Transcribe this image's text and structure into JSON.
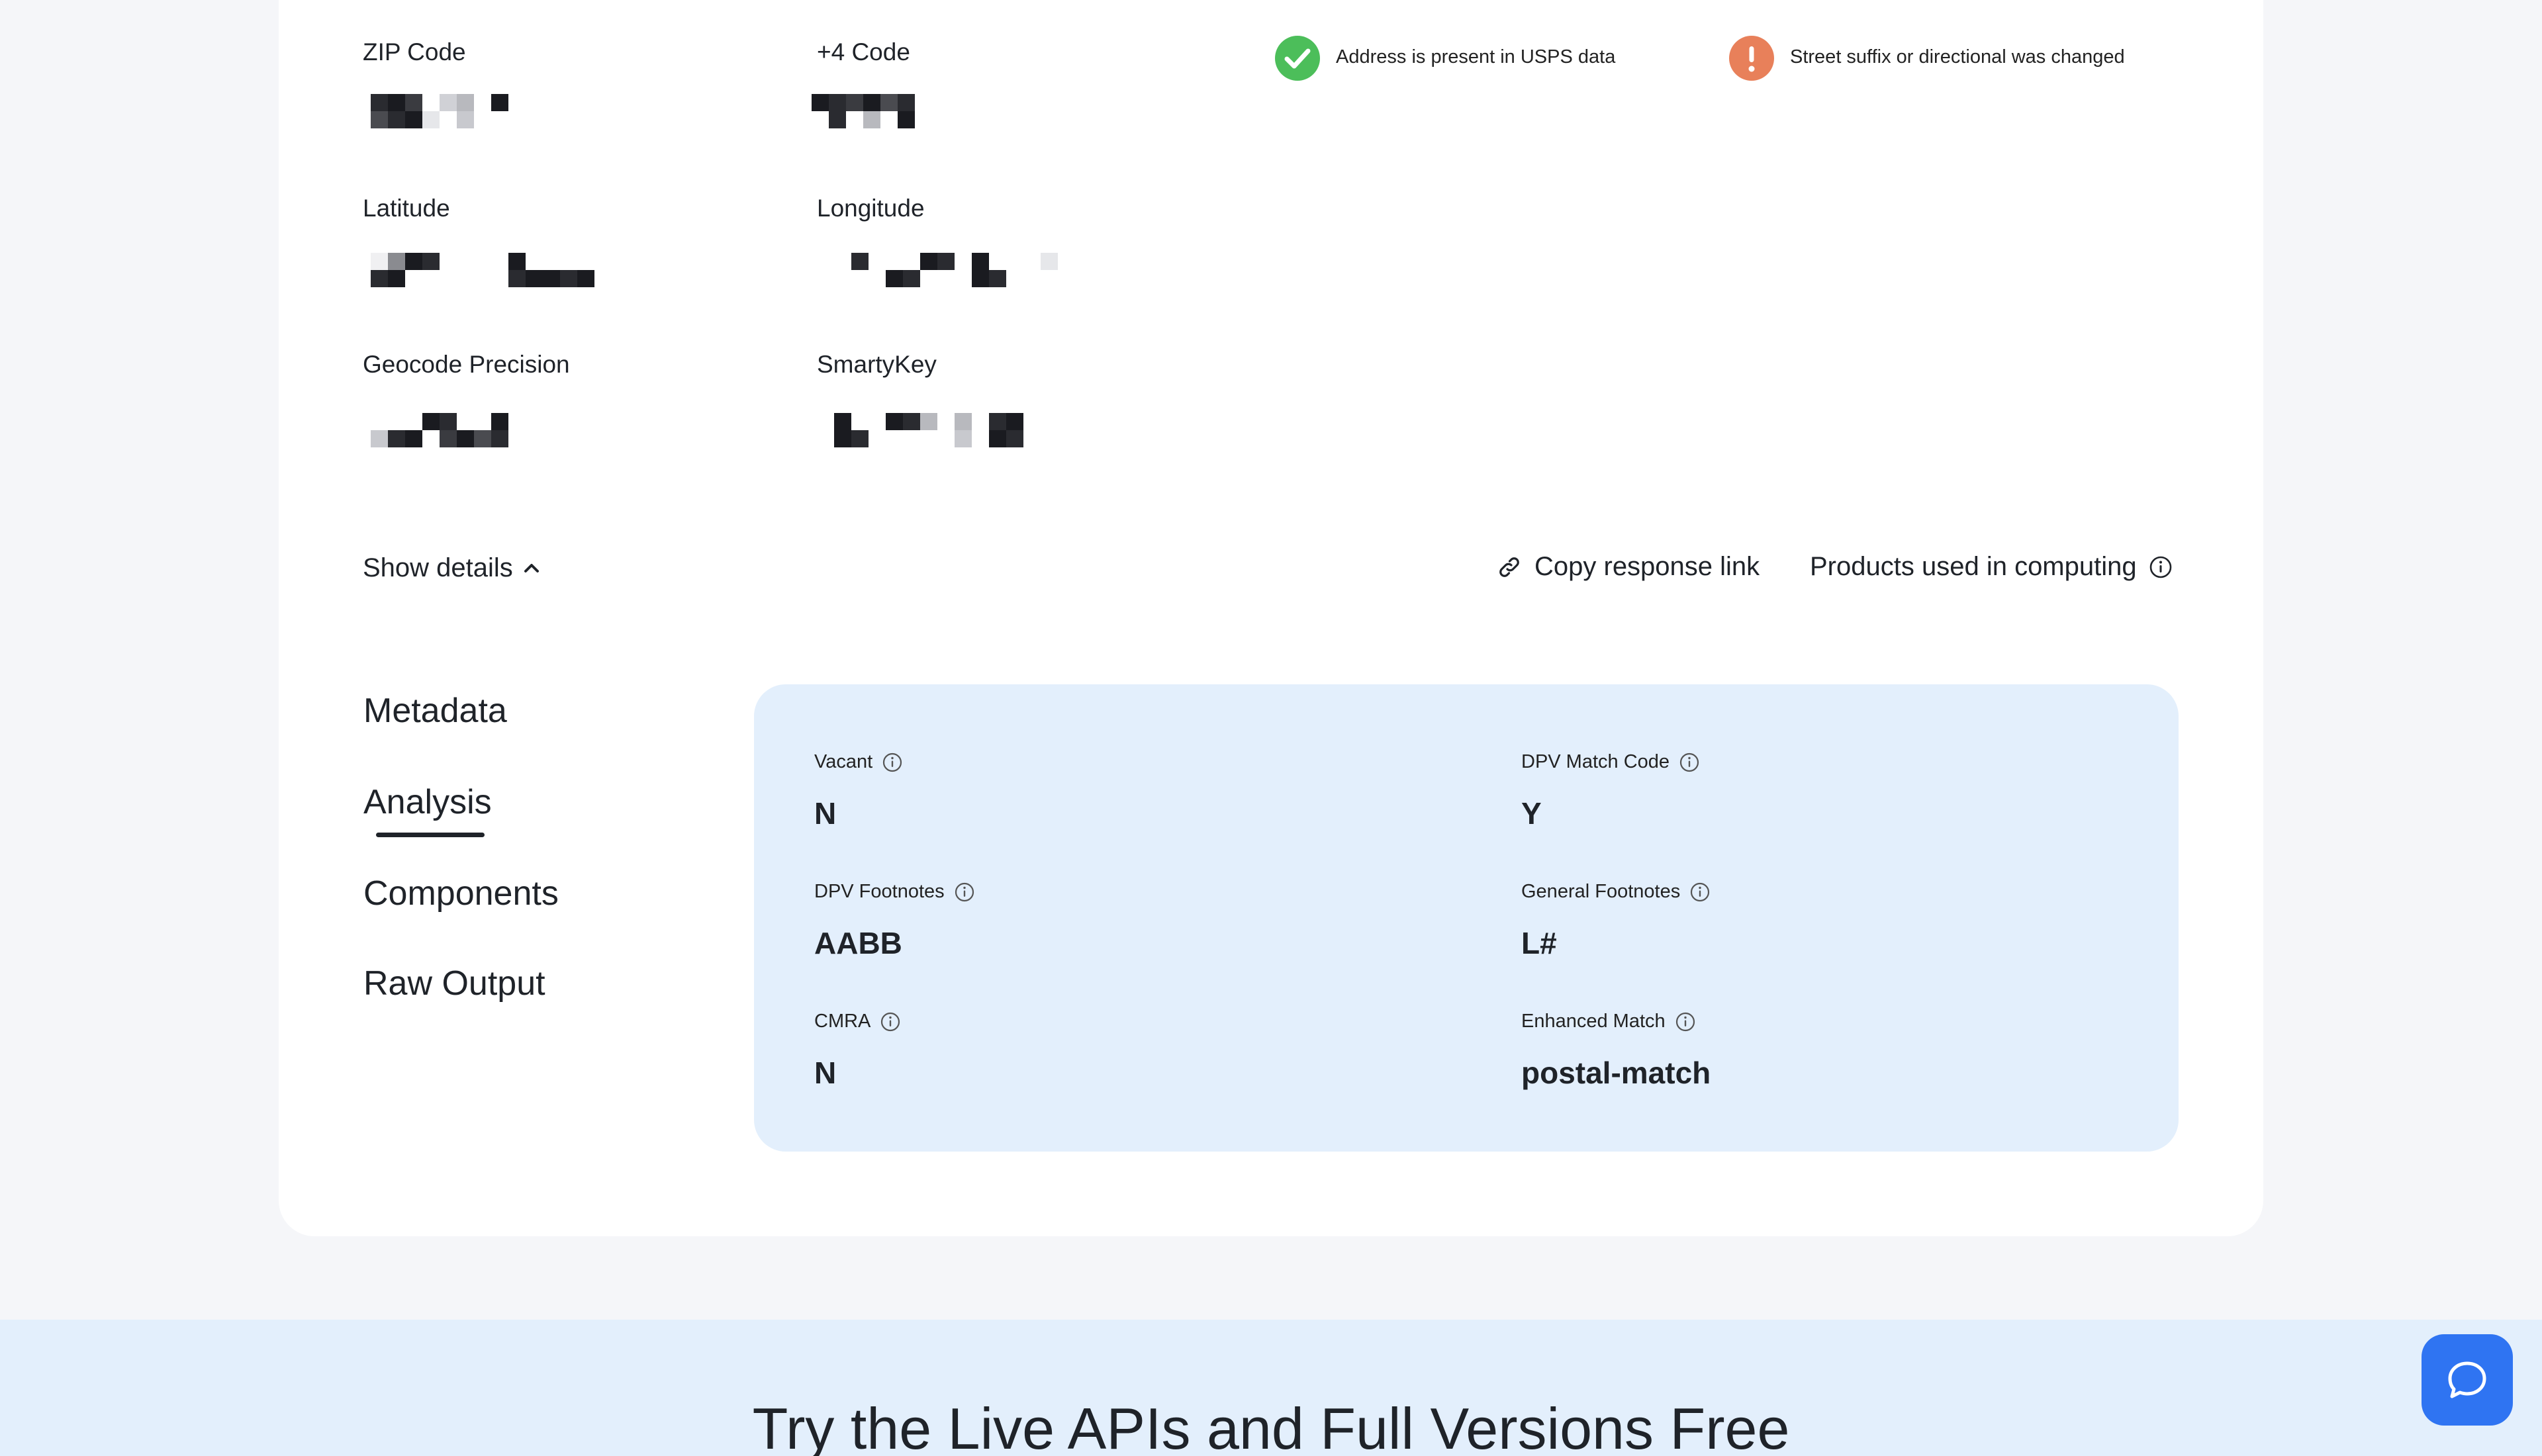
{
  "fields": {
    "zip_code": "ZIP Code",
    "plus4_code": "+4 Code",
    "latitude": "Latitude",
    "longitude": "Longitude",
    "geocode_precision": "Geocode Precision",
    "smartykey": "SmartyKey"
  },
  "badges": {
    "usps": "Address is present in USPS data",
    "suffix": "Street suffix or directional was changed"
  },
  "actions": {
    "show_details": "Show details",
    "copy_link": "Copy response link",
    "products": "Products used in computing"
  },
  "nav": {
    "metadata": "Metadata",
    "analysis": "Analysis",
    "components": "Components",
    "raw_output": "Raw Output",
    "active": "Analysis"
  },
  "analysis": {
    "vacant": {
      "label": "Vacant",
      "value": "N"
    },
    "dpv_match_code": {
      "label": "DPV Match Code",
      "value": "Y"
    },
    "dpv_footnotes": {
      "label": "DPV Footnotes",
      "value": "AABB"
    },
    "general_footnotes": {
      "label": "General Footnotes",
      "value": "L#"
    },
    "cmra": {
      "label": "CMRA",
      "value": "N"
    },
    "enhanced_match": {
      "label": "Enhanced Match",
      "value": "postal-match"
    }
  },
  "banner": {
    "title": "Try the Live APIs and Full Versions Free"
  },
  "icons": {
    "check": "check-circle-icon",
    "warning": "exclamation-circle-icon",
    "chevron": "chevron-up-icon",
    "link": "link-icon",
    "info": "info-icon",
    "chat": "chat-bubble-icon"
  },
  "colors": {
    "success": "#4cbe5a",
    "warning": "#e8805a",
    "panel": "#e3effc",
    "chat": "#2f74f2"
  }
}
